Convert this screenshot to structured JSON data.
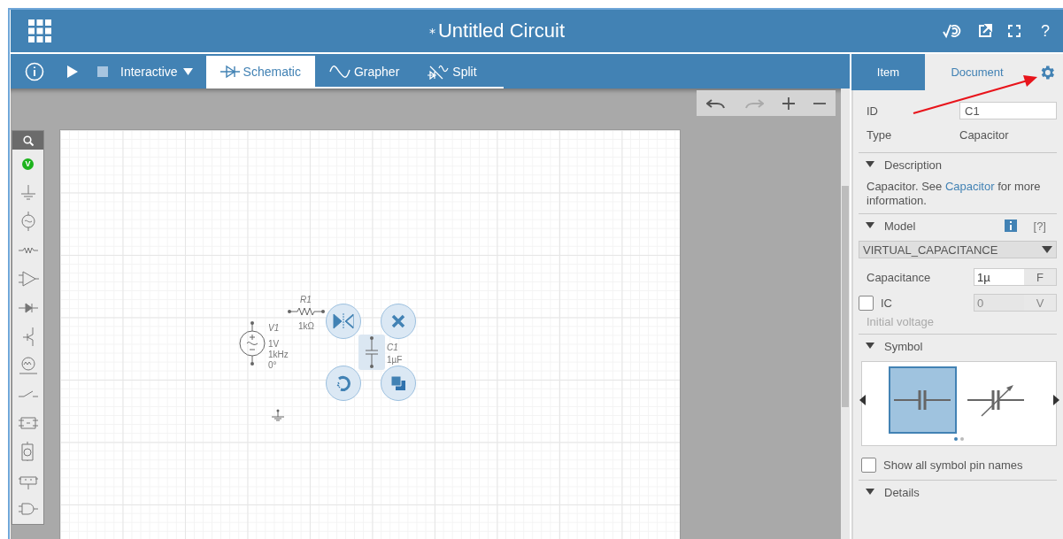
{
  "header": {
    "modified_mark": "*",
    "title": "Untitled Circuit",
    "help": "?"
  },
  "toolbar": {
    "mode": "Interactive",
    "views": [
      {
        "label": "Schematic",
        "kind": "schematic",
        "selected": true
      },
      {
        "label": "Grapher",
        "kind": "grapher",
        "selected": false
      },
      {
        "label": "Split",
        "kind": "split",
        "selected": false
      }
    ]
  },
  "circuit": {
    "parts": [
      {
        "kind": "source",
        "name": "V1",
        "values": [
          "1V",
          "1kHz",
          "0°"
        ]
      },
      {
        "kind": "resistor",
        "name": "R1",
        "values": [
          "1kΩ"
        ]
      },
      {
        "kind": "capacitor",
        "name": "C1",
        "values": [
          "1µF"
        ],
        "selected": true
      },
      {
        "kind": "ground"
      }
    ]
  },
  "palette": {
    "probe_letter": "V"
  },
  "panel": {
    "tabs": [
      {
        "label": "Item",
        "selected": true
      },
      {
        "label": "Document",
        "selected": false
      }
    ],
    "id": {
      "label": "ID",
      "value": "C1"
    },
    "type": {
      "label": "Type",
      "value": "Capacitor"
    },
    "sections": [
      {
        "kind": "description",
        "title": "Description",
        "expanded": true,
        "text_before": "Capacitor. See ",
        "link": "Capacitor",
        "text_after": " for more information."
      },
      {
        "kind": "model",
        "title": "Model",
        "expanded": true,
        "help": "[?]",
        "model": "VIRTUAL_CAPACITANCE",
        "capacitance": {
          "label": "Capacitance",
          "value": "1µ",
          "unit": "F"
        },
        "ic": {
          "label": "IC",
          "checked": false,
          "value": "0",
          "unit": "V",
          "disabled": true,
          "hint": "Initial voltage"
        }
      },
      {
        "kind": "symbol",
        "title": "Symbol",
        "expanded": true,
        "options": [
          {
            "kind": "fixed",
            "selected": true
          },
          {
            "kind": "variable",
            "selected": false
          }
        ],
        "pages": [
          {
            "selected": true
          },
          {
            "selected": false
          }
        ],
        "show_pin_names": {
          "label": "Show all symbol pin names",
          "checked": false
        }
      },
      {
        "kind": "details",
        "title": "Details",
        "expanded": true
      }
    ]
  }
}
